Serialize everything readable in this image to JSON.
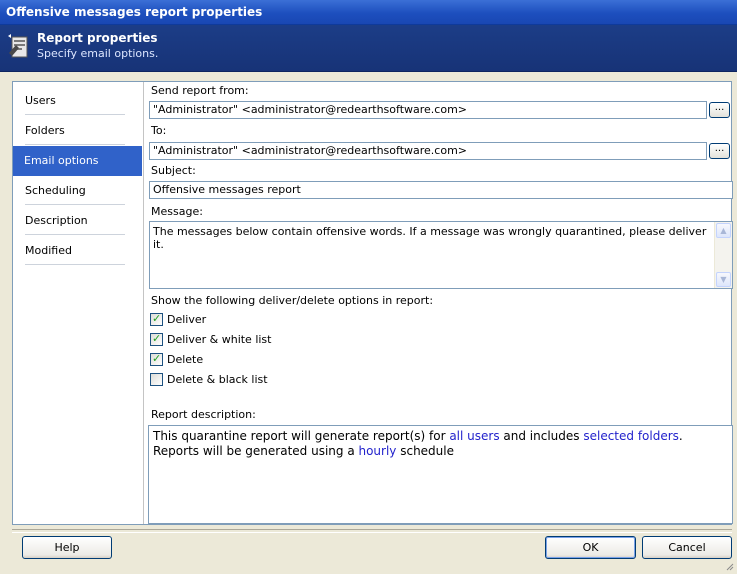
{
  "window": {
    "title": "Offensive messages report properties"
  },
  "header": {
    "title": "Report properties",
    "subtitle": "Specify email options."
  },
  "sidebar": {
    "items": [
      {
        "label": "Users",
        "selected": false
      },
      {
        "label": "Folders",
        "selected": false
      },
      {
        "label": "Email options",
        "selected": true
      },
      {
        "label": "Scheduling",
        "selected": false
      },
      {
        "label": "Description",
        "selected": false
      },
      {
        "label": "Modified",
        "selected": false
      }
    ]
  },
  "form": {
    "from_label": "Send report from:",
    "from_value": "\"Administrator\" <administrator@redearthsoftware.com>",
    "to_label": "To:",
    "to_value": "\"Administrator\" <administrator@redearthsoftware.com>",
    "browse_label": "...",
    "subject_label": "Subject:",
    "subject_value": "Offensive messages report",
    "message_label": "Message:",
    "message_value": "The messages below contain offensive words. If a message was wrongly quarantined, please deliver it.",
    "options_label": "Show the following deliver/delete options in report:",
    "options": [
      {
        "label": "Deliver",
        "checked": true
      },
      {
        "label": "Deliver & white list",
        "checked": true
      },
      {
        "label": "Delete",
        "checked": true
      },
      {
        "label": "Delete & black list",
        "checked": false
      }
    ],
    "description_label": "Report description:",
    "description": {
      "p1": "This quarantine report will generate report(s) for ",
      "link1": "all users",
      "p2": " and includes ",
      "link2": "selected folders",
      "p3": ".",
      "p4": "Reports will be generated using a ",
      "link3": "hourly",
      "p5": " schedule"
    }
  },
  "buttons": {
    "help": "Help",
    "ok": "OK",
    "cancel": "Cancel"
  },
  "colors": {
    "title_bar": "#1d4fbe",
    "header": "#173377",
    "selected_nav": "#3062c9",
    "link": "#2222cc"
  }
}
